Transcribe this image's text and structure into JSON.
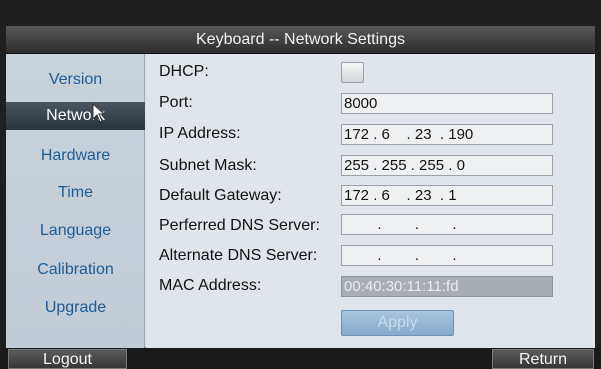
{
  "window": {
    "title": "Keyboard -- Network Settings"
  },
  "sidebar": {
    "items": [
      {
        "label": "Version"
      },
      {
        "label": "Network"
      },
      {
        "label": "Hardware"
      },
      {
        "label": "Time"
      },
      {
        "label": "Language"
      },
      {
        "label": "Calibration"
      },
      {
        "label": "Upgrade"
      }
    ]
  },
  "form": {
    "dhcp_label": "DHCP:",
    "port_label": "Port:",
    "port_value": "8000",
    "ip_label": "IP Address:",
    "ip_value": "172 . 6    . 23  . 190",
    "subnet_label": "Subnet Mask:",
    "subnet_value": "255 . 255 . 255 . 0",
    "gateway_label": "Default Gateway:",
    "gateway_value": "172 . 6    . 23  . 1",
    "pref_dns_label": "Perferred DNS Server:",
    "pref_dns_value": "        .        .        .",
    "alt_dns_label": "Alternate DNS Server:",
    "alt_dns_value": "        .        .        .",
    "mac_label": "MAC Address:",
    "mac_value": "00:40:30:11:11:fd",
    "apply_label": "Apply"
  },
  "bottom": {
    "logout_label": "Logout",
    "return_label": "Return"
  }
}
